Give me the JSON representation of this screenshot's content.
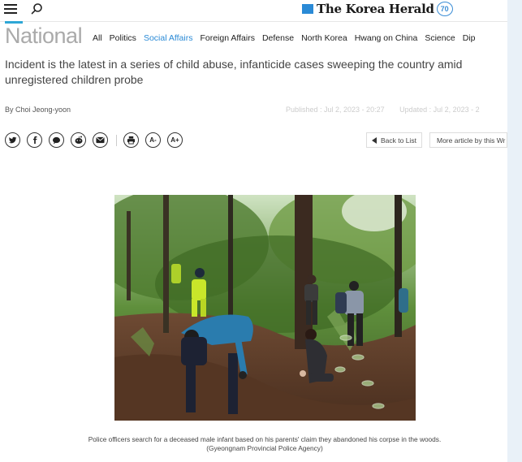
{
  "header": {
    "brand_name": "The Korea Herald",
    "brand_badge": "70",
    "icons": [
      "menu-icon",
      "search-icon"
    ]
  },
  "section": {
    "title": "National",
    "nav": [
      {
        "label": "All"
      },
      {
        "label": "Politics"
      },
      {
        "label": "Social Affairs",
        "active": true
      },
      {
        "label": "Foreign Affairs"
      },
      {
        "label": "Defense"
      },
      {
        "label": "North Korea"
      },
      {
        "label": "Hwang on China"
      },
      {
        "label": "Science"
      },
      {
        "label": "Dip"
      }
    ]
  },
  "article": {
    "headline": "Incident is the latest in a series of child abuse, infanticide cases sweeping the country amid unregistered children probe",
    "byline": "By Choi Jeong-yoon",
    "published": "Published : Jul 2, 2023 - 20:27",
    "updated": "Updated : Jul 2, 2023 - 2",
    "caption": "Police officers search for a deceased male infant based on his parents' claim they abandoned his corpse in the woods. (Gyeongnam Provincial Police Agency)"
  },
  "share": {
    "buttons": [
      "twitter-icon",
      "facebook-icon",
      "kakaotalk-icon",
      "reddit-icon",
      "email-icon"
    ],
    "print_icon": "print-icon",
    "font_decrease": "A-",
    "font_increase": "A+"
  },
  "actions": {
    "back_to_list": "Back to List",
    "more_by_writer": "More article by this Wr"
  },
  "colors": {
    "accent": "#2a8ad6",
    "section_title": "#aaaaaa"
  }
}
